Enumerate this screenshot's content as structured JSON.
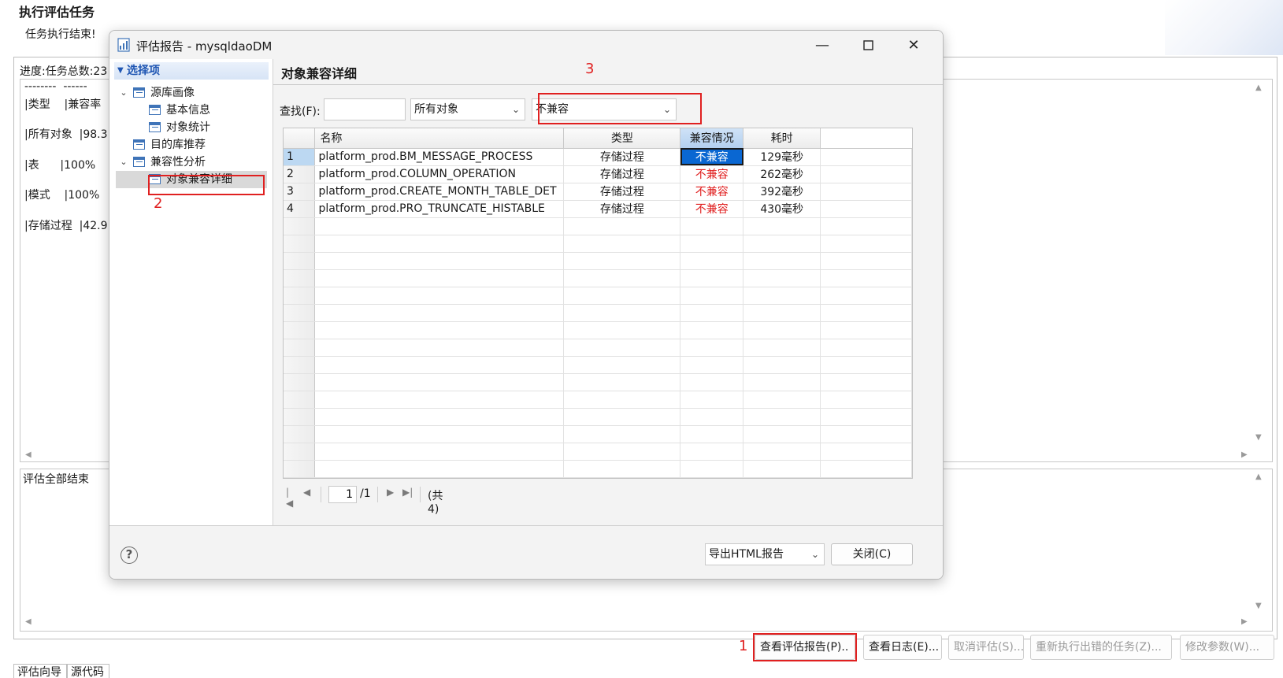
{
  "main": {
    "title": "执行评估任务",
    "subtitle": "任务执行结束!",
    "progress": "进度:任务总数:23",
    "stats": {
      "divider": "--------  ------",
      "header": "|类型    |兼容率",
      "rows": [
        "|所有对象  |98.3",
        "|表      |100%",
        "|模式    |100%",
        "|存储过程  |42.9"
      ]
    },
    "log": "评估全部结束",
    "buttons": {
      "view_report": "查看评估报告(P)..",
      "view_log": "查看日志(E)...",
      "cancel": "取消评估(S)...",
      "rerun": "重新执行出错的任务(Z)...",
      "modify": "修改参数(W)..."
    },
    "tabs": [
      "评估向导",
      "源代码"
    ]
  },
  "annotations": [
    "1",
    "2",
    "3"
  ],
  "dialog": {
    "title": "评估报告 - mysqldaoDM",
    "tree": {
      "header": "选择项",
      "items": [
        "源库画像",
        "基本信息",
        "对象统计",
        "目的库推荐",
        "兼容性分析",
        "对象兼容详细"
      ]
    },
    "content": {
      "title": "对象兼容详细",
      "find_label": "查找(F):",
      "find_value": "",
      "object_filter": "所有对象",
      "compat_filter": "不兼容",
      "columns": [
        "名称",
        "类型",
        "兼容情况",
        "耗时"
      ],
      "rows": [
        {
          "no": "1",
          "name": "platform_prod.BM_MESSAGE_PROCESS",
          "type": "存储过程",
          "status": "不兼容",
          "time": "129毫秒"
        },
        {
          "no": "2",
          "name": "platform_prod.COLUMN_OPERATION",
          "type": "存储过程",
          "status": "不兼容",
          "time": "262毫秒"
        },
        {
          "no": "3",
          "name": "platform_prod.CREATE_MONTH_TABLE_DET",
          "type": "存储过程",
          "status": "不兼容",
          "time": "392毫秒"
        },
        {
          "no": "4",
          "name": "platform_prod.PRO_TRUNCATE_HISTABLE",
          "type": "存储过程",
          "status": "不兼容",
          "time": "430毫秒"
        }
      ],
      "pager": {
        "page": "1",
        "total_pages": "/1",
        "count": "(共 4)"
      }
    },
    "footer": {
      "export": "导出HTML报告",
      "close": "关闭(C)"
    }
  },
  "colors": {
    "accent": "#0a67d2",
    "annotation": "#e02020",
    "incompatible": "#e02020"
  }
}
